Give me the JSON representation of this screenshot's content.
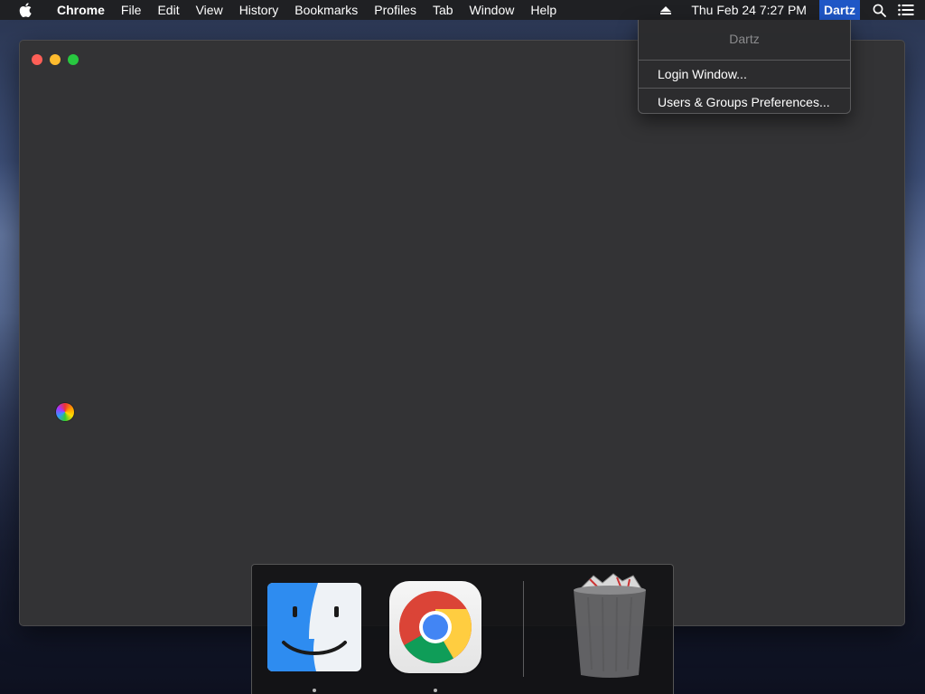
{
  "menubar": {
    "apple_icon": "apple-logo-icon",
    "app_name": "Chrome",
    "menus": [
      "File",
      "Edit",
      "View",
      "History",
      "Bookmarks",
      "Profiles",
      "Tab",
      "Window",
      "Help"
    ],
    "eject_icon": "eject-icon",
    "clock": "Thu Feb 24  7:27 PM",
    "user": "Dartz",
    "spotlight_icon": "spotlight-search-icon",
    "notification_icon": "notification-center-icon"
  },
  "user_dropdown": {
    "header": "Dartz",
    "items": [
      "Login Window...",
      "Users & Groups Preferences..."
    ]
  },
  "window": {
    "controls": [
      "close",
      "minimize",
      "maximize"
    ],
    "cursor": "spinning-wait-cursor"
  },
  "dock": {
    "items": [
      {
        "name": "Finder",
        "icon": "finder-icon",
        "running": true
      },
      {
        "name": "Google Chrome",
        "icon": "chrome-icon",
        "running": true
      },
      {
        "name": "Trash",
        "icon": "trash-icon",
        "running": false
      }
    ]
  },
  "colors": {
    "menubar_bg": "#1e1e20",
    "user_highlight": "#1f57c6",
    "window_bg": "#333335",
    "traffic_close": "#fe5f57",
    "traffic_min": "#febb2e",
    "traffic_max": "#28c840"
  }
}
